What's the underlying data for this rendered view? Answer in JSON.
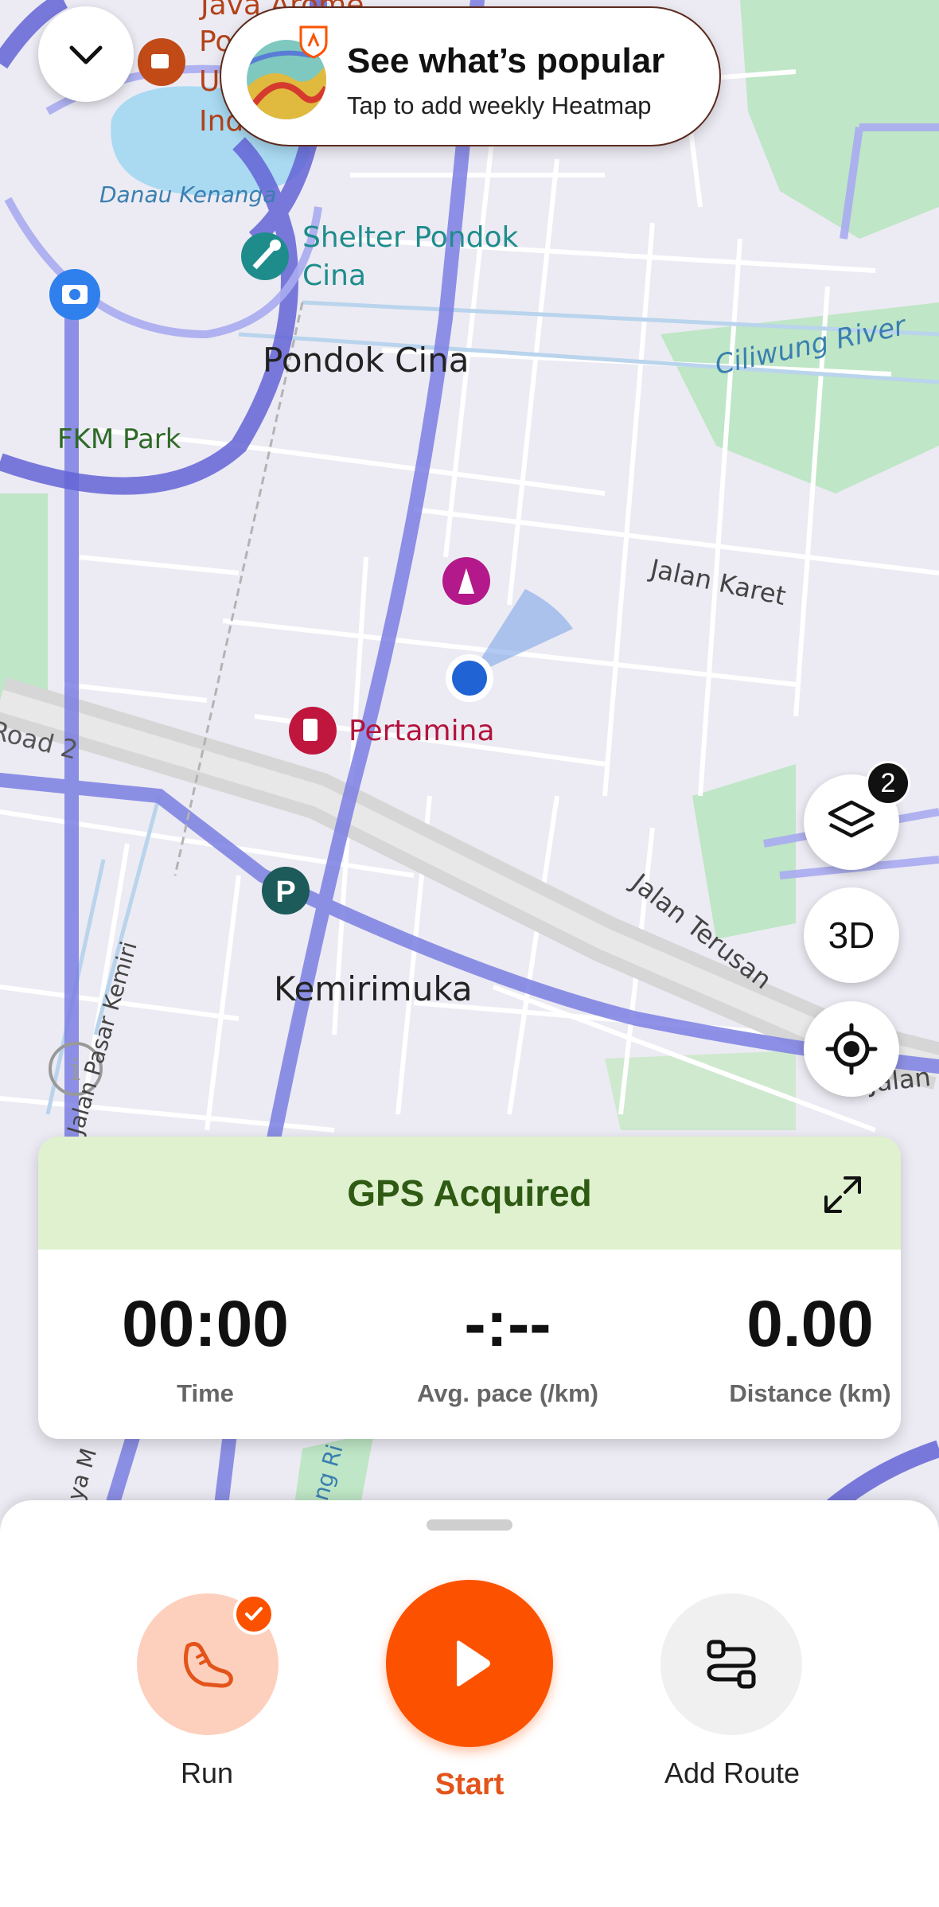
{
  "banner": {
    "title": "See what’s popular",
    "subtitle": "Tap to add weekly Heatmap"
  },
  "map": {
    "labels": {
      "java_arome": "Java Arome",
      "pu": "Po",
      "u": "U",
      "ind": "Ind",
      "danau": "Danau Kenanga",
      "shelter": "Shelter Pondok",
      "shelter2": "Cina",
      "pondok_cina": "Pondok Cina",
      "ciliwung": "Ciliwung River",
      "fkm": "FKM Park",
      "jalan_karet": "Jalan Karet",
      "pertamina": "Pertamina",
      "road2": "Road 2",
      "jalan_terusan": "Jalan Terusan",
      "kemirimuka": "Kemirimuka",
      "pasar_kemiri": "Jalan Pasar Kemiri",
      "jalan_right": "Jalan",
      "ya_m": "ya M",
      "ng_ri": "ng Ri"
    }
  },
  "controls": {
    "layers_badge": "2",
    "btn_3d": "3D"
  },
  "stats": {
    "gps_status": "GPS Acquired",
    "time_value": "00:00",
    "time_label": "Time",
    "pace_value": "-:--",
    "pace_label": "Avg. pace (/km)",
    "distance_value": "0.00",
    "distance_label": "Distance (km)"
  },
  "sheet": {
    "run_label": "Run",
    "start_label": "Start",
    "route_label": "Add Route"
  },
  "colors": {
    "accent": "#fc5200",
    "gps_bg": "#dff1cf",
    "gps_text": "#2f5a14",
    "heat": "#6f6fe0"
  }
}
